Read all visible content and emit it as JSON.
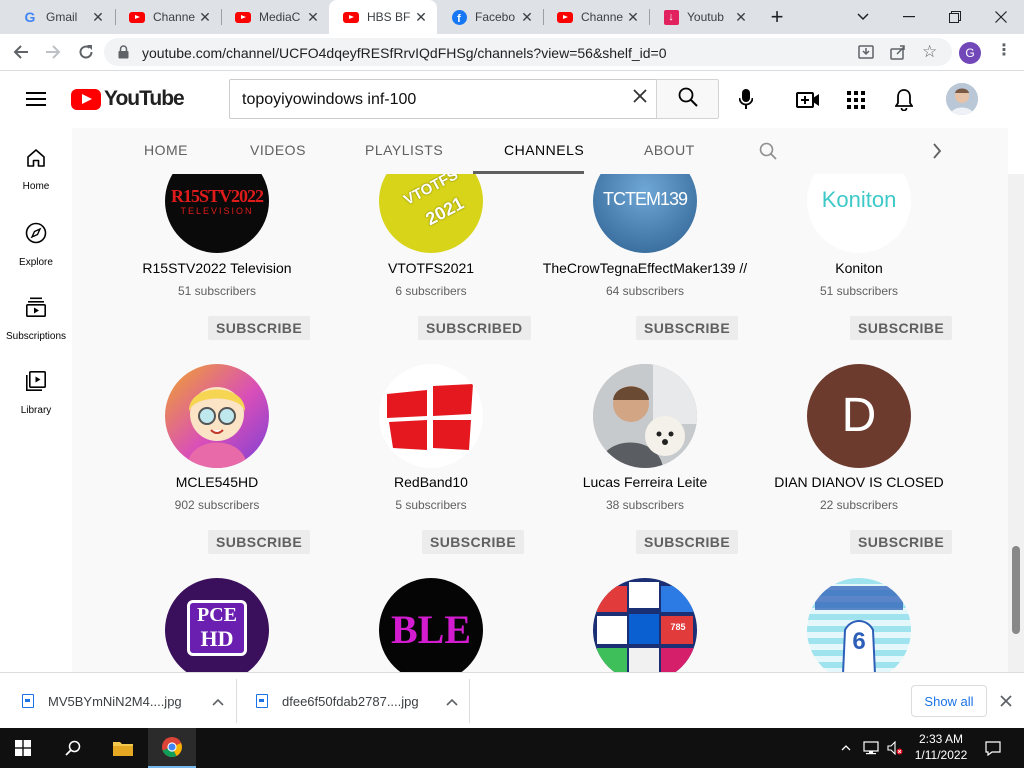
{
  "browser": {
    "tabs": [
      {
        "title": "Gmail",
        "icon": "gmail-icon"
      },
      {
        "title": "Channe",
        "icon": "youtube-icon"
      },
      {
        "title": "MediaC",
        "icon": "youtube-icon"
      },
      {
        "title": "HBS BF",
        "icon": "youtube-icon"
      },
      {
        "title": "Facebo",
        "icon": "facebook-icon"
      },
      {
        "title": "Channe",
        "icon": "youtube-icon"
      },
      {
        "title": "Youtub",
        "icon": "download-icon"
      }
    ],
    "url": "youtube.com/channel/UCFO4dqeyfRESfRrvIQdFHSg/channels?view=56&shelf_id=0",
    "profile_initial": "G"
  },
  "youtube": {
    "logo_text": "YouTube",
    "search_query": "topoyiyowindows inf-100",
    "guide": [
      {
        "label": "Home",
        "icon": "home-icon"
      },
      {
        "label": "Explore",
        "icon": "explore-icon"
      },
      {
        "label": "Subscriptions",
        "icon": "subscriptions-icon"
      },
      {
        "label": "Library",
        "icon": "library-icon"
      }
    ],
    "channel_tabs": [
      "HOME",
      "VIDEOS",
      "PLAYLISTS",
      "CHANNELS",
      "ABOUT"
    ],
    "active_tab": "CHANNELS",
    "channels": [
      {
        "name": "R15STV2022 Television",
        "subscribers": "51 subscribers",
        "button": "SUBSCRIBE",
        "avatar_text": "R15STV2022",
        "avatar_subtext": "TELEVISION"
      },
      {
        "name": "VTOTFS2021",
        "subscribers": "6 subscribers",
        "button": "SUBSCRIBED",
        "avatar_text": "VTOTFS",
        "avatar_subtext": "2021"
      },
      {
        "name": "TheCrowTegnaEffectMaker139 //",
        "subscribers": "64 subscribers",
        "button": "SUBSCRIBE",
        "avatar_text": "TCTEM139"
      },
      {
        "name": "Koniton",
        "subscribers": "51 subscribers",
        "button": "SUBSCRIBE",
        "avatar_text": "Koniton"
      },
      {
        "name": "MCLE545HD",
        "subscribers": "902 subscribers",
        "button": "SUBSCRIBE"
      },
      {
        "name": "RedBand10",
        "subscribers": "5 subscribers",
        "button": "SUBSCRIBE"
      },
      {
        "name": "Lucas Ferreira Leite",
        "subscribers": "38 subscribers",
        "button": "SUBSCRIBE"
      },
      {
        "name": "DIAN DIANOV IS CLOSED",
        "subscribers": "22 subscribers",
        "button": "SUBSCRIBE",
        "avatar_text": "D"
      }
    ],
    "partial_row": [
      {
        "avatar_text": "PCE",
        "avatar_subtext": "HD"
      },
      {
        "avatar_text": "BLE"
      },
      {
        "avatar_text": "785"
      },
      {
        "avatar_text": "6"
      }
    ]
  },
  "downloads": {
    "items": [
      "MV5BYmNiN2M4....jpg",
      "dfee6f50fdab2787....jpg"
    ],
    "show_all": "Show all"
  },
  "taskbar": {
    "time": "2:33 AM",
    "date": "1/11/2022"
  },
  "colors": {
    "youtube_red": "#ff0000",
    "accent_blue": "#1a73e8",
    "dian_avatar": "#6d3a2e"
  }
}
